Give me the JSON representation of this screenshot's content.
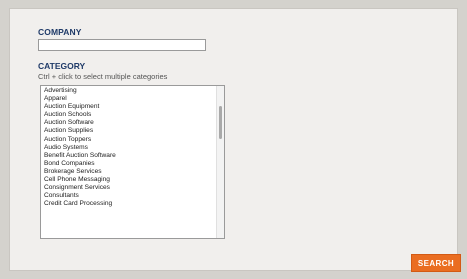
{
  "company": {
    "label": "COMPANY",
    "value": ""
  },
  "category": {
    "label": "CATEGORY",
    "hint": "Ctrl + click to select multiple categories",
    "items": [
      "Advertising",
      "Apparel",
      "Auction Equipment",
      "Auction Schools",
      "Auction Software",
      "Auction Supplies",
      "Auction Toppers",
      "Audio Systems",
      "Benefit Auction Software",
      "Bond Companies",
      "Brokerage Services",
      "Cell Phone Messaging",
      "Consignment Services",
      "Consultants",
      "Credit Card Processing"
    ]
  },
  "search": {
    "button_label": "SEARCH"
  },
  "colors": {
    "label_navy": "#1f3a68",
    "button_orange": "#ea6d21",
    "panel_bg": "#f1efed"
  }
}
